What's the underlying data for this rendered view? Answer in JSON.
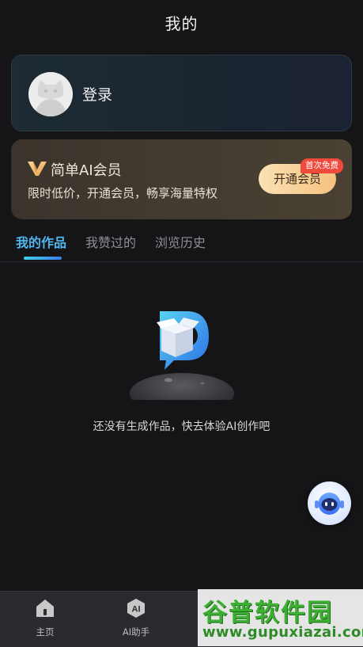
{
  "header": {
    "title": "我的"
  },
  "login_card": {
    "label": "登录"
  },
  "vip_card": {
    "title": "简单AI会员",
    "description": "限时低价，开通会员，畅享海量特权",
    "button_label": "开通会员",
    "badge": "首次免费"
  },
  "tabs": [
    {
      "label": "我的作品",
      "active": true
    },
    {
      "label": "我赞过的",
      "active": false
    },
    {
      "label": "浏览历史",
      "active": false
    }
  ],
  "empty_state": {
    "text": "还没有生成作品，快去体验AI创作吧"
  },
  "bottom_nav": [
    {
      "label": "主页",
      "icon": "home-icon"
    },
    {
      "label": "AI助手",
      "icon": "ai-badge-icon"
    }
  ],
  "watermark": {
    "title": "谷普软件园",
    "url": "www.gupuxiazai.com"
  },
  "colors": {
    "background": "#151517",
    "tab_active": "#4fb6ef",
    "vip_button": "#f5c27e",
    "badge": "#ef4a3c"
  }
}
